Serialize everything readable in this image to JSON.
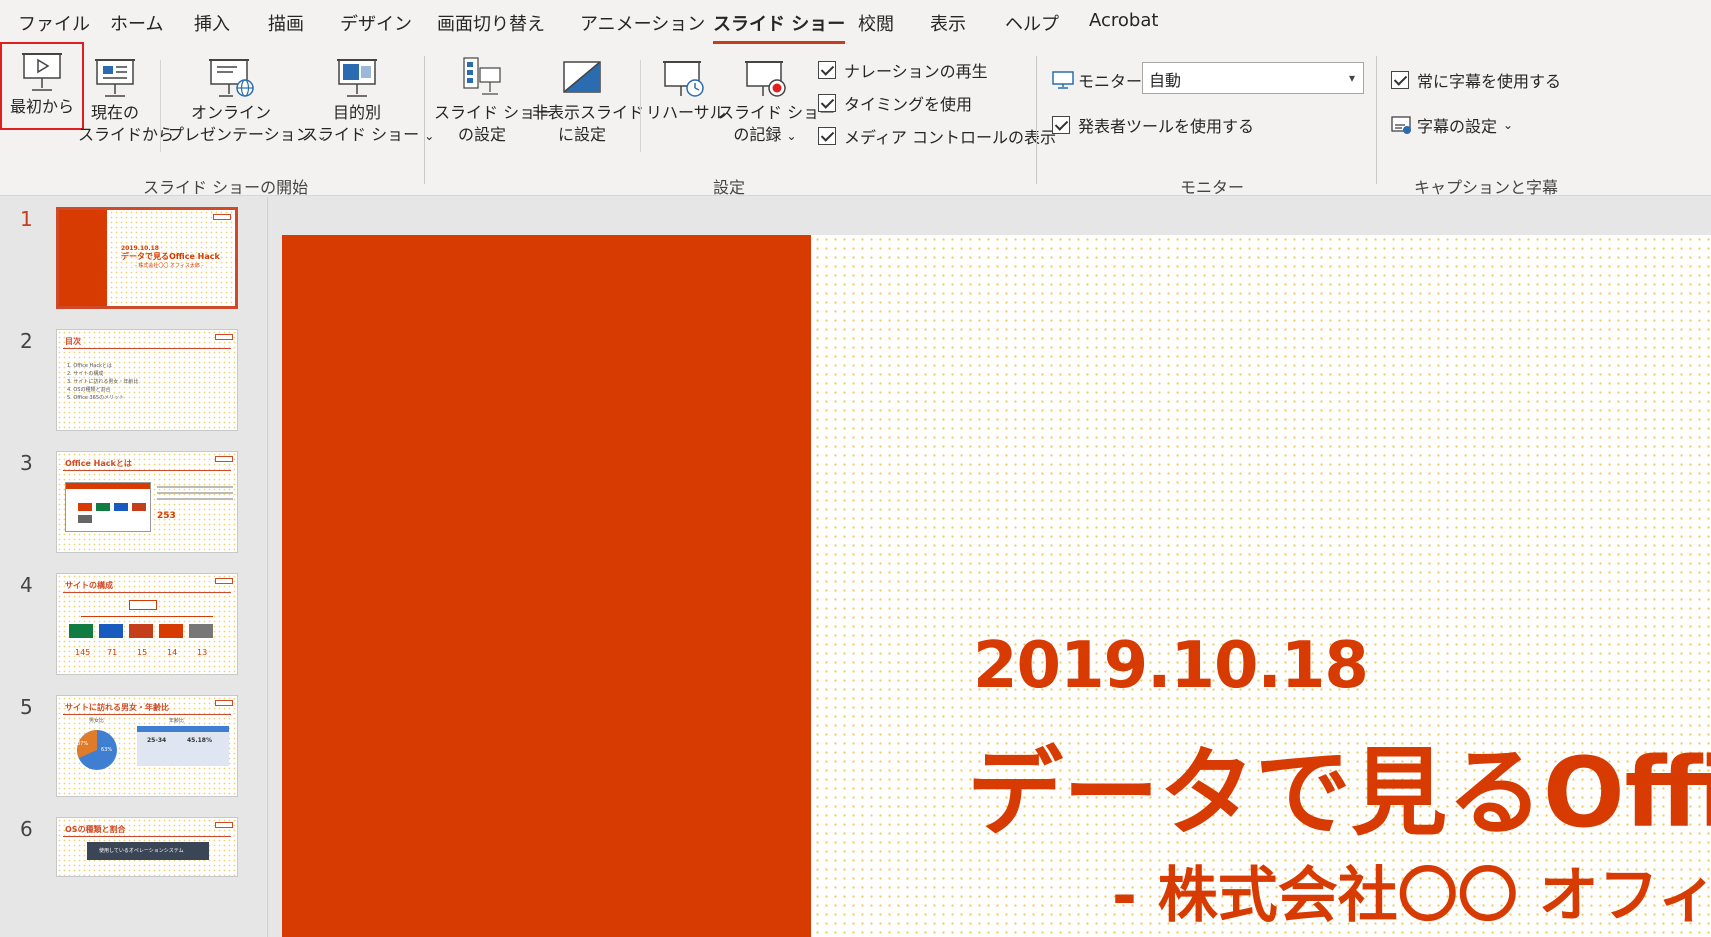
{
  "tabs": [
    "ファイル",
    "ホーム",
    "挿入",
    "描画",
    "デザイン",
    "画面切り替え",
    "アニメーション",
    "スライド ショー",
    "校閲",
    "表示",
    "ヘルプ",
    "Acrobat"
  ],
  "active_tab": "スライド ショー",
  "ribbon": {
    "start_group": {
      "label": "スライド ショーの開始",
      "from_beginning": "最初から",
      "from_current_1": "現在の",
      "from_current_2": "スライドから",
      "online_1": "オンライン",
      "online_2": "プレゼンテーション",
      "custom_1": "目的別",
      "custom_2": "スライド ショー"
    },
    "setup_group": {
      "label": "設定",
      "setup_1": "スライド ショー",
      "setup_2": "の設定",
      "hide_1": "非表示スライド",
      "hide_2": "に設定",
      "rehearse": "リハーサル",
      "record_1": "スライド ショー",
      "record_2": "の記録",
      "play_narration": "ナレーションの再生",
      "use_timings": "タイミングを使用",
      "media_controls": "メディア コントロールの表示"
    },
    "monitor_group": {
      "label": "モニター",
      "monitor_label": "モニター:",
      "monitor_value": "自動",
      "presenter_view": "発表者ツールを使用する"
    },
    "caption_group": {
      "label": "キャプションと字幕",
      "always_subtitles": "常に字幕を使用する",
      "subtitle_settings": "字幕の設定"
    }
  },
  "thumbnails": {
    "numbers": [
      "1",
      "2",
      "3",
      "4",
      "5",
      "6"
    ],
    "t1": {
      "date": "2019.10.18",
      "title": "データで見るOffice Hack",
      "sub": "- 株式会社〇〇 オフィス太郎 -"
    },
    "t2": {
      "head": "目次",
      "items": [
        "1. Office Hackとは",
        "2. サイトの構成",
        "3. サイトに訪れる男女・年齢比",
        "4. OSの種類と割合",
        "5. Office 365のメリット"
      ]
    },
    "t3": {
      "head": "Office Hackとは",
      "num": "253"
    },
    "t4": {
      "head": "サイトの構成",
      "nums": [
        "145",
        "71",
        "15",
        "14",
        "13"
      ]
    },
    "t5": {
      "head": "サイトに訪れる男女・年齢比",
      "sub1": "男女比",
      "sub2": "年齢比",
      "p1": "37%",
      "p2": "63%",
      "r1": "25-34",
      "r2": "45.18%"
    },
    "t6": {
      "head": "OSの種類と割合",
      "bar": "使用しているオペレーションシステム"
    }
  },
  "slide": {
    "date": "2019.10.18",
    "title": "データで見るOffice Hack",
    "subtitle": "- 株式会社〇〇 オフィス太郎 -"
  },
  "colors": {
    "accent": "#d83b01",
    "tab_underline": "#c43e1c",
    "highlight": "#e02020"
  }
}
